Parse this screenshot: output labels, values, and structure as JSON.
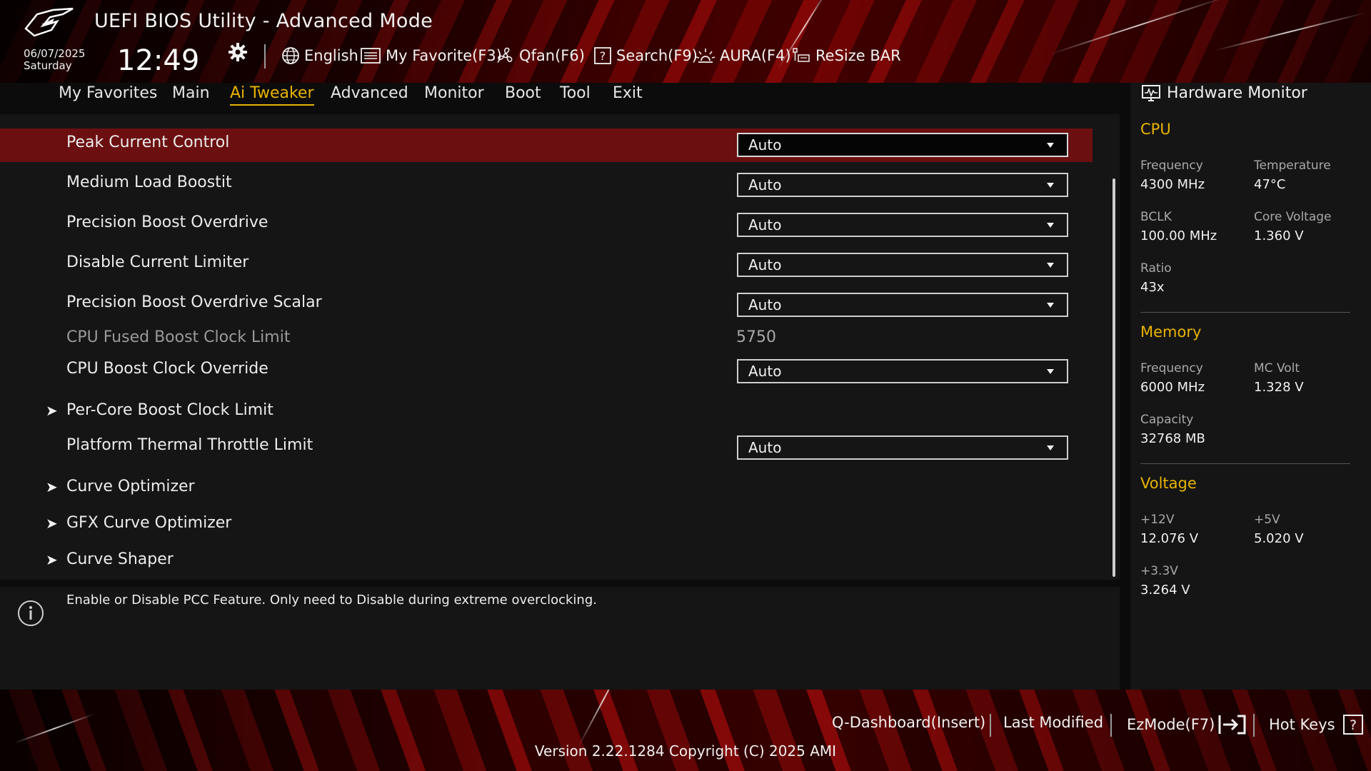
{
  "header": {
    "title": "UEFI BIOS Utility - Advanced Mode",
    "date": "06/07/2025",
    "day": "Saturday",
    "time": "12:49"
  },
  "toolbar": {
    "language": "English",
    "my_favorite": "My Favorite(F3)",
    "qfan": "Qfan(F6)",
    "search": "Search(F9)",
    "aura": "AURA(F4)",
    "resize_bar": "ReSize BAR"
  },
  "nav": {
    "tabs": [
      {
        "label": "My Favorites"
      },
      {
        "label": "Main"
      },
      {
        "label": "Ai Tweaker",
        "active": true
      },
      {
        "label": "Advanced"
      },
      {
        "label": "Monitor"
      },
      {
        "label": "Boot"
      },
      {
        "label": "Tool"
      },
      {
        "label": "Exit"
      }
    ]
  },
  "settings": [
    {
      "label": "Peak Current Control",
      "value": "Auto",
      "type": "dropdown",
      "selected": true
    },
    {
      "label": "Medium Load Boostit",
      "value": "Auto",
      "type": "dropdown"
    },
    {
      "label": "Precision Boost Overdrive",
      "value": "Auto",
      "type": "dropdown"
    },
    {
      "label": "Disable Current Limiter",
      "value": "Auto",
      "type": "dropdown"
    },
    {
      "label": "Precision Boost Overdrive Scalar",
      "value": "Auto",
      "type": "dropdown"
    },
    {
      "label": "CPU Fused Boost Clock Limit",
      "value": "5750",
      "type": "readonly"
    },
    {
      "label": "CPU Boost Clock Override",
      "value": "Auto",
      "type": "dropdown"
    },
    {
      "label": "Per-Core Boost Clock Limit",
      "type": "submenu"
    },
    {
      "label": "Platform Thermal Throttle Limit",
      "value": "Auto",
      "type": "dropdown"
    },
    {
      "label": "Curve Optimizer",
      "type": "submenu"
    },
    {
      "label": "GFX Curve Optimizer",
      "type": "submenu"
    },
    {
      "label": "Curve Shaper",
      "type": "submenu"
    }
  ],
  "help": {
    "text": "Enable or Disable PCC Feature. Only need to Disable during extreme overclocking."
  },
  "hardware_monitor": {
    "title": "Hardware Monitor",
    "cpu": {
      "heading": "CPU",
      "frequency_label": "Frequency",
      "frequency": "4300 MHz",
      "temperature_label": "Temperature",
      "temperature": "47°C",
      "bclk_label": "BCLK",
      "bclk": "100.00 MHz",
      "core_voltage_label": "Core Voltage",
      "core_voltage": "1.360 V",
      "ratio_label": "Ratio",
      "ratio": "43x"
    },
    "memory": {
      "heading": "Memory",
      "frequency_label": "Frequency",
      "frequency": "6000 MHz",
      "mc_volt_label": "MC Volt",
      "mc_volt": "1.328 V",
      "capacity_label": "Capacity",
      "capacity": "32768 MB"
    },
    "voltage": {
      "heading": "Voltage",
      "v12_label": "+12V",
      "v12": "12.076 V",
      "v5_label": "+5V",
      "v5": "5.020 V",
      "v33_label": "+3.3V",
      "v33": "3.264 V"
    }
  },
  "footer": {
    "q_dashboard": "Q-Dashboard(Insert)",
    "last_modified": "Last Modified",
    "ezmode": "EzMode(F7)",
    "hot_keys": "Hot Keys",
    "version": "Version 2.22.1284 Copyright (C) 2025 AMI"
  },
  "colors": {
    "accent": "#e8b400",
    "highlight_row": "#6b0f10",
    "panel": "#151515"
  }
}
